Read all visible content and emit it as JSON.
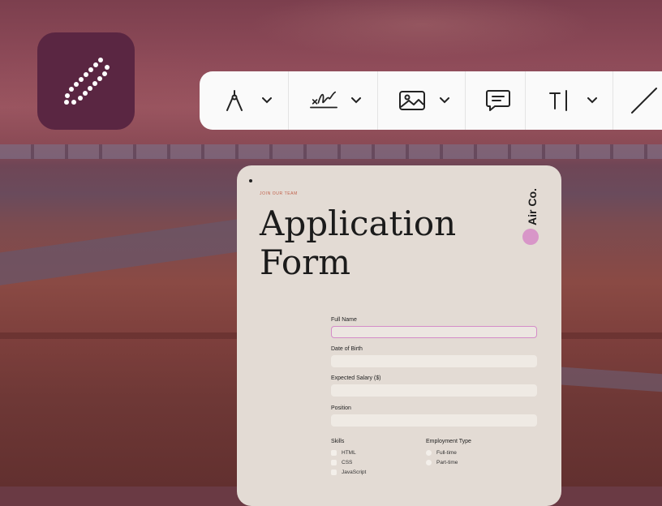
{
  "toolbar": {
    "tools": [
      {
        "icon": "pen-nib-icon",
        "has_dropdown": true
      },
      {
        "icon": "signature-icon",
        "has_dropdown": true
      },
      {
        "icon": "image-icon",
        "has_dropdown": true
      },
      {
        "icon": "comment-icon",
        "has_dropdown": false
      },
      {
        "icon": "text-tool-icon",
        "has_dropdown": true
      },
      {
        "icon": "line-tool-icon",
        "has_dropdown": false
      }
    ]
  },
  "app_icon": {
    "icon": "dotted-pencil-icon",
    "color": "#5a2642"
  },
  "form": {
    "eyebrow": "JOIN OUR TEAM",
    "title": "Application Form",
    "brand": "Air Co.",
    "accent_color": "#d896c8",
    "fields": [
      {
        "label": "Full Name",
        "value": "",
        "active": true
      },
      {
        "label": "Date of Birth",
        "value": ""
      },
      {
        "label": "Expected Salary ($)",
        "value": ""
      },
      {
        "label": "Position",
        "value": ""
      }
    ],
    "skills": {
      "label": "Skills",
      "options": [
        "HTML",
        "CSS",
        "JavaScript"
      ]
    },
    "employment": {
      "label": "Employment Type",
      "options": [
        "Full-time",
        "Part-time"
      ]
    }
  }
}
